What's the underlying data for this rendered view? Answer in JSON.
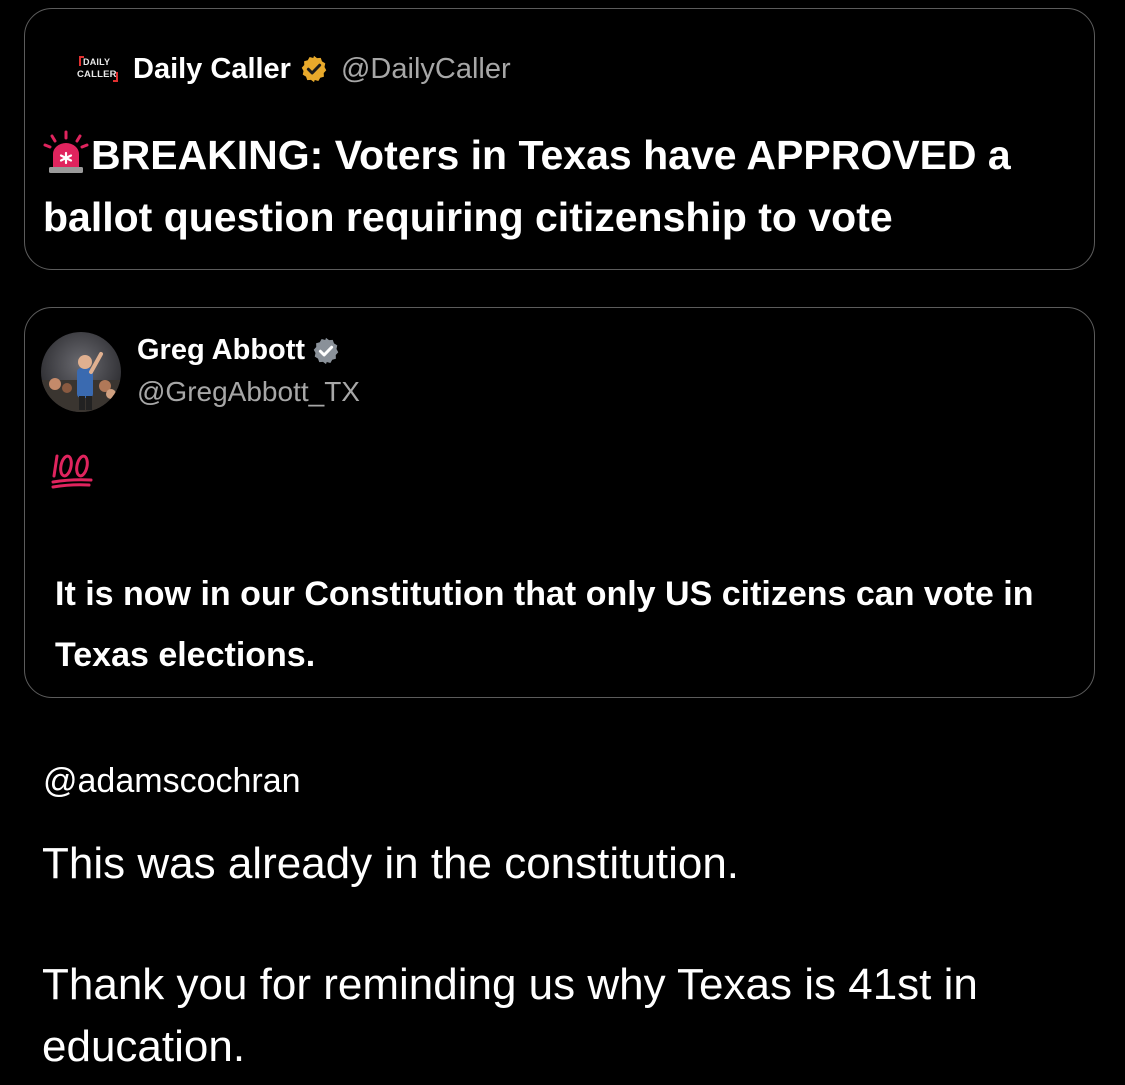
{
  "quoted_post": {
    "logo_text_top": "DAILY",
    "logo_text_bottom": "CALLER",
    "author_name": "Daily Caller",
    "author_handle": "@DailyCaller",
    "verified_badge": "gold-verified-badge-icon",
    "alert_icon": "police-siren-emoji",
    "text": "BREAKING: Voters in Texas have APPROVED a ballot question requiring citizenship to vote"
  },
  "main_post": {
    "author_name": "Greg Abbott",
    "author_handle": "@GregAbbott_TX",
    "verified_badge": "gray-verified-badge-icon",
    "reaction_icon": "hundred-points-emoji",
    "text": "It is now in our Constitution that only US citizens can vote in Texas elections."
  },
  "reply": {
    "handle": "@adamscochran",
    "paragraph1": "This was already in the constitution.",
    "paragraph2": "Thank you for reminding us why Texas is 41st in education."
  },
  "colors": {
    "background": "#000000",
    "card_border": "#5c5c5c",
    "primary_text": "#ffffff",
    "secondary_text": "#a7a7a7",
    "gold_badge": "#e8a92b",
    "emoji_red": "#e0245e"
  }
}
